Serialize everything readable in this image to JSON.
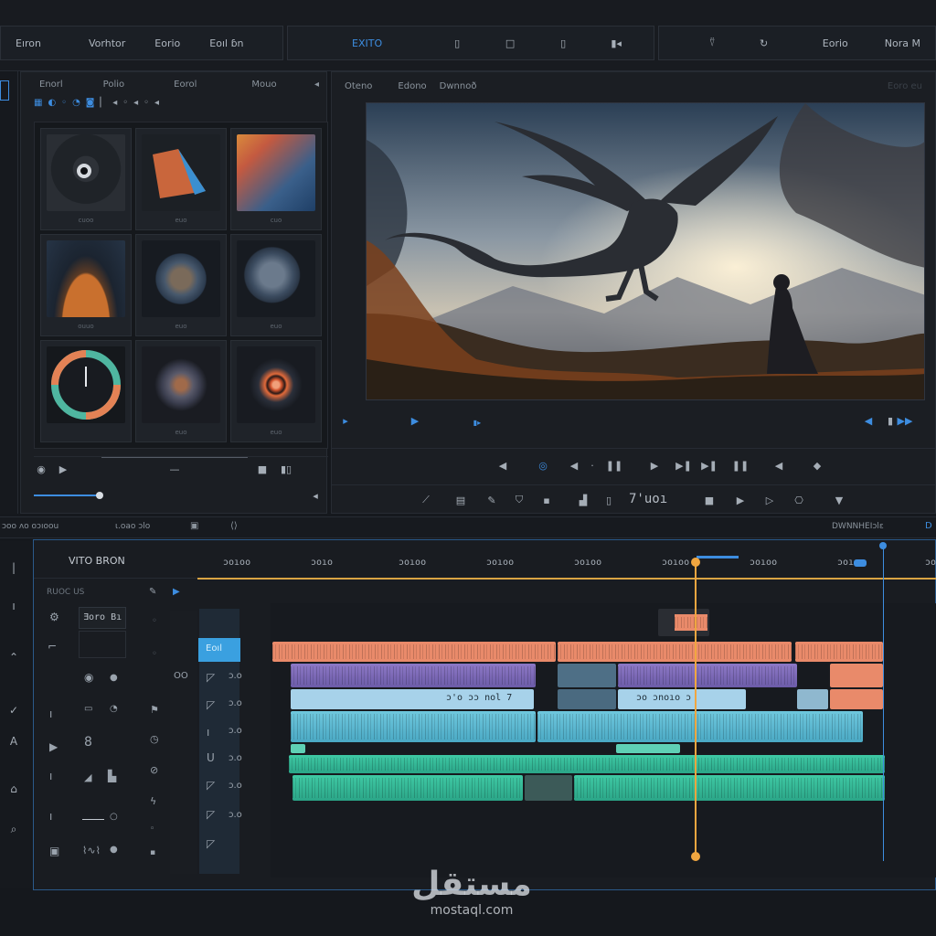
{
  "menu": {
    "group1": [
      "Eıron",
      "Vorhtor",
      "Eorio",
      "Eoıl ɓn"
    ],
    "group2_active": "EXITO",
    "group3": [
      "Eorio",
      "Nora M"
    ]
  },
  "media": {
    "tabs": [
      "Enorl",
      "Polio",
      "Eorol",
      "Mouo"
    ],
    "captions": [
      "cuoo",
      "euo",
      "cuo",
      "ouuo",
      "euo",
      "euo",
      "",
      "euo",
      "euo"
    ]
  },
  "viewer": {
    "tabs": [
      "Oteno",
      "Edono",
      "Dwnnoð"
    ],
    "corner": "Eoro eu",
    "timecode": "7'uoı"
  },
  "timeline": {
    "bar_left": "ɔoo ʌo oɔıoou",
    "bar_mid": "ɩ.oao ɔlo",
    "bar_right": "DWNNHEIɔlɛ",
    "sequence_name": "VITO BRON",
    "sub_label": "RUOC US",
    "ruler_labels": [
      "ɔoıoo",
      "ɔoıo",
      "ɔoıoo",
      "ɔoıoo",
      "ɔoıoo",
      "ɔoıoo",
      "ɔoıoo",
      "ɔoıoo",
      "ɔoıoo"
    ],
    "track_label": "Ǝoro Bı",
    "selected_label": "Eoıl",
    "clip_labels": [
      "ɔ'o ɔɔ nol 7",
      "ɔo ɔnoıo ɔ"
    ],
    "row_labels": [
      "OO",
      "ɔ.o",
      "ɔ.o",
      "ɔ.o",
      "ɔ.o",
      "ɔ.o",
      "ɔ.o"
    ]
  },
  "watermark": {
    "arabic": "مستقل",
    "url": "mostaql.com"
  },
  "colors": {
    "accent": "#3d8de0",
    "playhead": "#f0a640",
    "audio_orange": "#e98a6a",
    "video_purple": "#8d78c6",
    "cyan": "#6fc7dd",
    "green": "#3fc9a4"
  }
}
